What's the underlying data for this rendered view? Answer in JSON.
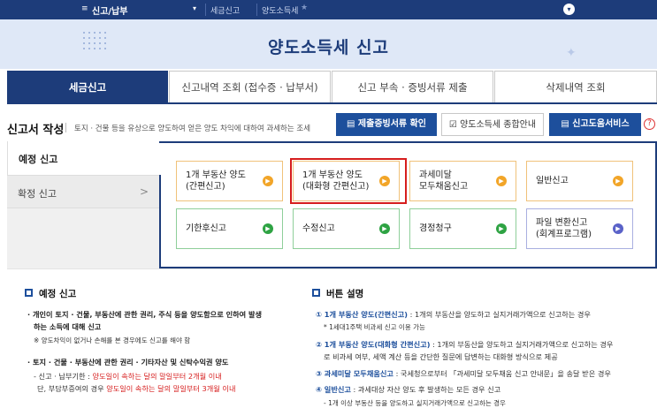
{
  "topbar": {
    "menu_label": "신고/납부",
    "crumb1": "세금신고",
    "crumb2": "양도소득세"
  },
  "banner": {
    "title": "양도소득세 신고"
  },
  "tabs": [
    {
      "label": "세금신고",
      "active": true
    },
    {
      "label": "신고내역 조회 (접수증 · 납부서)",
      "active": false
    },
    {
      "label": "신고 부속 · 증빙서류 제출",
      "active": false
    },
    {
      "label": "삭제내역 조회",
      "active": false
    }
  ],
  "section": {
    "title": "신고서 작성",
    "desc": "토지 · 건물 등을 유상으로 양도하여 얻은 양도 차익에 대하여 과세하는 조세",
    "btn_docs": "제출증빙서류 확인",
    "btn_guide": "양도소득세 종합안내",
    "btn_help": "신고도움서비스",
    "help_mark": "?"
  },
  "leftmenu": [
    {
      "label": "예정 신고",
      "active": true
    },
    {
      "label": "확정 신고",
      "active": false,
      "arrow": ">"
    }
  ],
  "options": [
    {
      "line1": "1개 부동산 양도",
      "line2": "(간편신고)",
      "color": "orange"
    },
    {
      "line1": "1개 부동산 양도",
      "line2": "(대화형 간편신고)",
      "color": "orange"
    },
    {
      "line1": "과세미달",
      "line2": "모두채움신고",
      "color": "orange"
    },
    {
      "line1": "일반신고",
      "line2": "",
      "color": "orange"
    },
    {
      "line1": "기한후신고",
      "line2": "",
      "color": "green"
    },
    {
      "line1": "수정신고",
      "line2": "",
      "color": "green"
    },
    {
      "line1": "경정청구",
      "line2": "",
      "color": "green"
    },
    {
      "line1": "파일 변환신고",
      "line2": "(회계프로그램)",
      "color": "purple"
    }
  ],
  "info_left": {
    "heading": "예정 신고",
    "l1": "· 개인이 토지 · 건물, 부동산에 관한 권리, 주식 등을 양도함으로 인하여 발생",
    "l2": "하는 소득에 대해 신고",
    "l3": "※ 양도차익이 없거나 손해를 본 경우에도 신고를 해야 함",
    "l4": "· 토지 · 건물 · 부동산에 관한 권리 · 기타자산 및 신탁수익권 양도",
    "l5a": "- 신고 · 납부기한 : ",
    "l5b": "양도일이 속하는 달의 말일부터 2개월 이내",
    "l6a": "단, 부담부증여의 경우 ",
    "l6b": "양도일이 속하는 달의 말일부터 3개월 이내"
  },
  "info_right": {
    "heading": "버튼 설명",
    "r1a": "① 1개 부동산 양도(간편신고)",
    "r1b": " : 1개의 부동산을 양도하고 실지거래가액으로 신고하는 경우",
    "r2": "* 1세대1주택 비과세 신고 이용 가능",
    "r3a": "② 1개 부동산 양도(대화형 간편신고)",
    "r3b": " : 1개의 부동산을 양도하고 실지거래가액으로 신고하는 경우",
    "r4": "로 비과세 여부, 세액 계산 등을 간단한 질문에 답변하는 대화형 방식으로 제공",
    "r5a": "③ 과세미달 모두채움신고",
    "r5b": " : 국세청으로부터 「과세미달 모두채움 신고 안내문」을 송달 받은 경우",
    "r6a": "④ 일반신고",
    "r6b": " : 과세대상 자산 양도 후 발생하는 모든 경우 신고",
    "r7": "- 1개 이상 부동산 등을 양도하고 실지거래가액으로 신고하는 경우"
  }
}
